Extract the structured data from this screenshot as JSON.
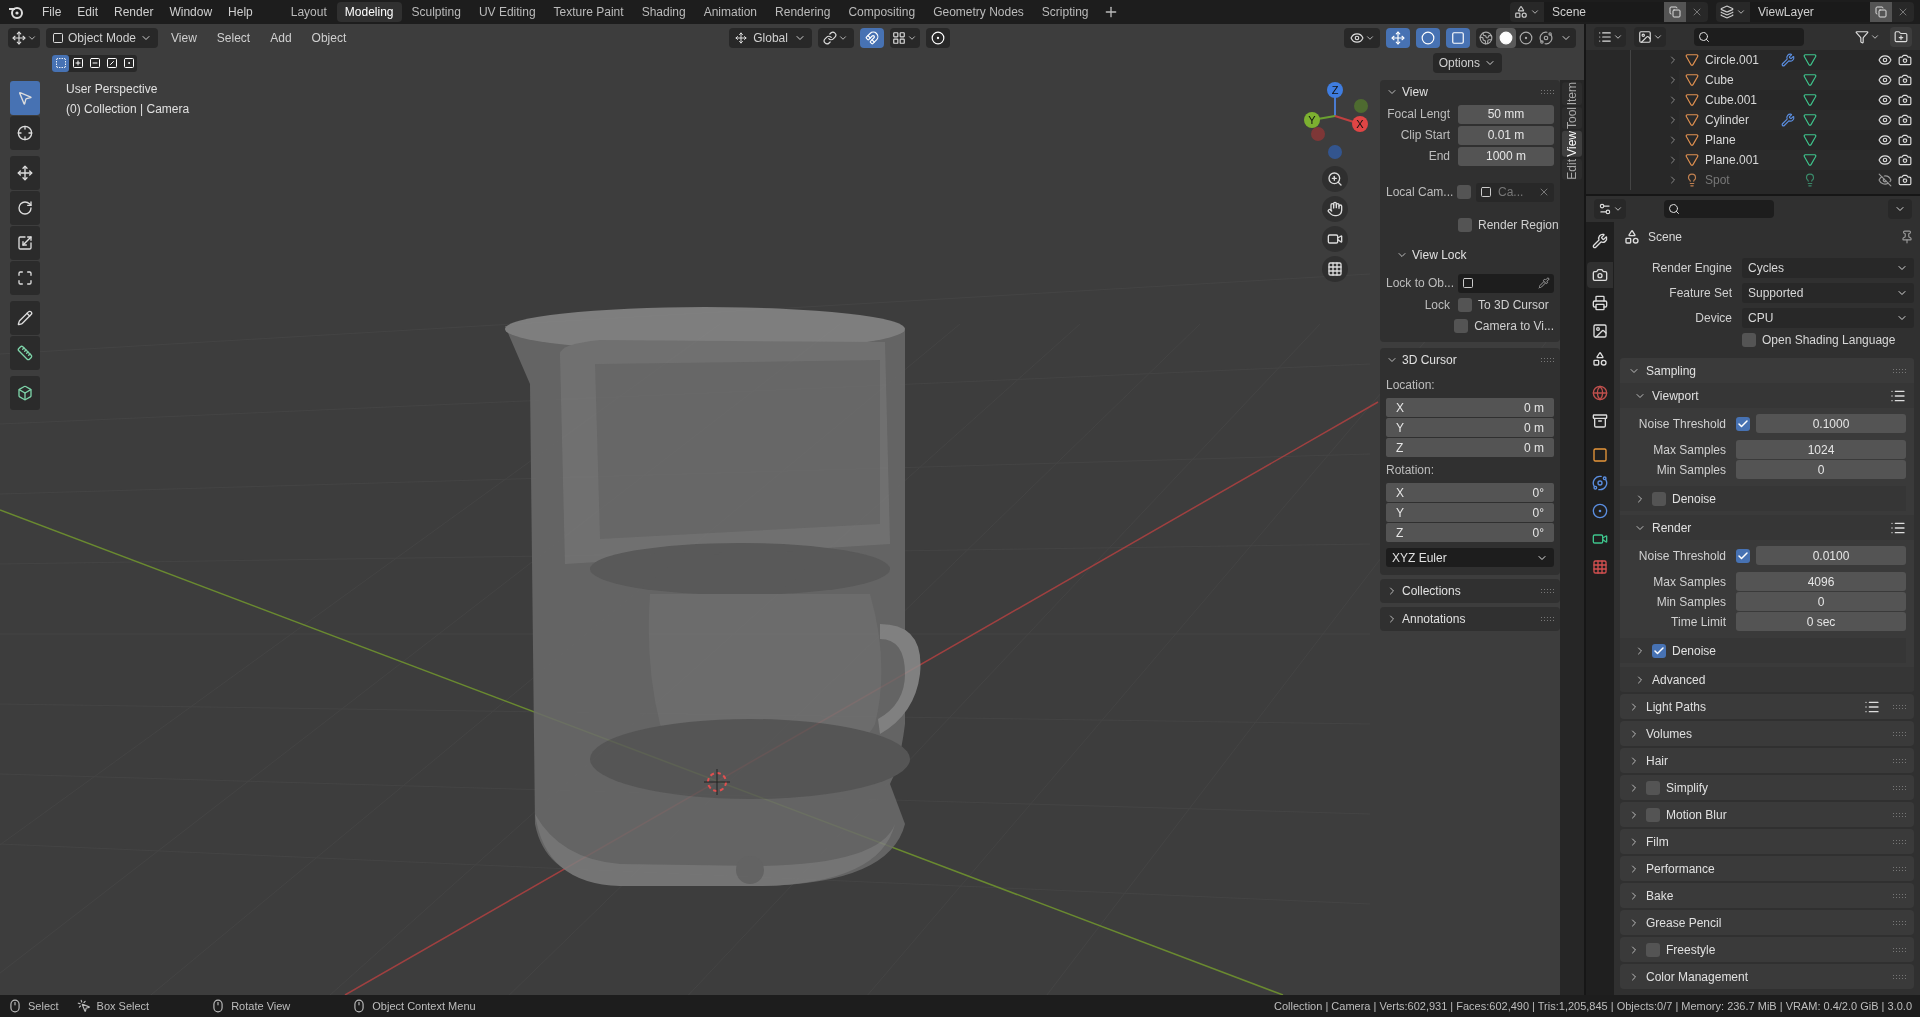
{
  "menu_bar": [
    "File",
    "Edit",
    "Render",
    "Window",
    "Help"
  ],
  "workspace_tabs": [
    {
      "label": "Layout",
      "selected": false
    },
    {
      "label": "Modeling",
      "selected": true
    },
    {
      "label": "Sculpting",
      "selected": false
    },
    {
      "label": "UV Editing",
      "selected": false
    },
    {
      "label": "Texture Paint",
      "selected": false
    },
    {
      "label": "Shading",
      "selected": false
    },
    {
      "label": "Animation",
      "selected": false
    },
    {
      "label": "Rendering",
      "selected": false
    },
    {
      "label": "Compositing",
      "selected": false
    },
    {
      "label": "Geometry Nodes",
      "selected": false
    },
    {
      "label": "Scripting",
      "selected": false
    }
  ],
  "scene": "Scene",
  "view_layer": "ViewLayer",
  "viewport_header": {
    "mode": "Object Mode",
    "menus": [
      "View",
      "Select",
      "Add",
      "Object"
    ],
    "orientation": "Global",
    "snapping": true,
    "proportional_editing": false,
    "gizmos_on": true,
    "overlays_on": true,
    "xray_on": true,
    "shading_modes": [
      {
        "kind": "wireframe",
        "selected": false
      },
      {
        "kind": "solid",
        "selected": true
      },
      {
        "kind": "material",
        "selected": false
      },
      {
        "kind": "rendered",
        "selected": false
      }
    ],
    "select_modes": [
      {
        "kind": "set",
        "selected": true
      },
      {
        "kind": "extend",
        "selected": false
      },
      {
        "kind": "subtract",
        "selected": false
      },
      {
        "kind": "invert",
        "selected": false
      },
      {
        "kind": "intersect",
        "selected": false
      }
    ],
    "options": "Options"
  },
  "viewport": {
    "perspective": "User Perspective",
    "context": "(0) Collection | Camera",
    "gizmo": {
      "x": "X",
      "y": "Y",
      "z": "Z"
    }
  },
  "tools": [
    {
      "kind": "select",
      "selected": true
    },
    {
      "kind": "cursor",
      "selected": false
    },
    {
      "kind": "move",
      "selected": false
    },
    {
      "kind": "rotate",
      "selected": false
    },
    {
      "kind": "scale",
      "selected": false
    },
    {
      "kind": "transform",
      "selected": false
    },
    {
      "kind": "annotate",
      "selected": false
    },
    {
      "kind": "measure",
      "selected": false
    },
    {
      "kind": "add-cube",
      "selected": false
    }
  ],
  "sidebar": {
    "tabs": [
      {
        "label": "Item",
        "selected": false
      },
      {
        "label": "Tool",
        "selected": false
      },
      {
        "label": "View",
        "selected": true
      },
      {
        "label": "Edit",
        "selected": false
      }
    ],
    "view_panel": {
      "title": "View",
      "expanded": true,
      "fields": [
        {
          "label": "Focal Lengt",
          "value": "50 mm"
        },
        {
          "label": "Clip Start",
          "value": "0.01 m"
        },
        {
          "label": "End",
          "value": "1000 m"
        }
      ],
      "local_camera": {
        "label": "Local Cam...",
        "checked": false,
        "object": "Ca..."
      },
      "render_region": {
        "label": "Render Region",
        "checked": false
      },
      "view_lock": {
        "title": "View Lock",
        "expanded": true,
        "lock_to_object": "Lock to Ob...",
        "lock": "Lock",
        "options": [
          {
            "label": "To 3D Cursor",
            "checked": false
          },
          {
            "label": "Camera to Vi...",
            "checked": false
          }
        ]
      }
    },
    "cursor_panel": {
      "title": "3D Cursor",
      "expanded": true,
      "location_label": "Location:",
      "location": [
        {
          "axis": "X",
          "value": "0 m"
        },
        {
          "axis": "Y",
          "value": "0 m"
        },
        {
          "axis": "Z",
          "value": "0 m"
        }
      ],
      "rotation_label": "Rotation:",
      "rotation": [
        {
          "axis": "X",
          "value": "0°"
        },
        {
          "axis": "Y",
          "value": "0°"
        },
        {
          "axis": "Z",
          "value": "0°"
        }
      ],
      "rotation_mode": "XYZ Euler"
    },
    "collapsed_panels": [
      {
        "title": "Collections",
        "expanded": false
      },
      {
        "title": "Annotations",
        "expanded": false
      }
    ]
  },
  "outliner": [
    {
      "name": "Circle.001",
      "kind": "mesh",
      "modifier": true,
      "visible": true
    },
    {
      "name": "Cube",
      "kind": "mesh",
      "modifier": false,
      "visible": true
    },
    {
      "name": "Cube.001",
      "kind": "mesh",
      "modifier": false,
      "visible": true
    },
    {
      "name": "Cylinder",
      "kind": "mesh",
      "modifier": true,
      "visible": true
    },
    {
      "name": "Plane",
      "kind": "mesh",
      "modifier": false,
      "visible": true
    },
    {
      "name": "Plane.001",
      "kind": "mesh",
      "modifier": false,
      "visible": true
    },
    {
      "name": "Spot",
      "kind": "light",
      "modifier": false,
      "visible": false
    }
  ],
  "properties": {
    "tabs": [
      {
        "kind": "tool",
        "selected": false
      },
      {
        "kind": "render",
        "selected": true
      },
      {
        "kind": "output",
        "selected": false
      },
      {
        "kind": "view-layer",
        "selected": false
      },
      {
        "kind": "scene",
        "selected": false
      },
      {
        "kind": "world",
        "selected": false
      },
      {
        "kind": "collection",
        "selected": false
      },
      {
        "kind": "object",
        "selected": false
      },
      {
        "kind": "physics",
        "selected": false
      },
      {
        "kind": "constraint",
        "selected": false
      },
      {
        "kind": "data",
        "selected": false
      },
      {
        "kind": "texture",
        "selected": false
      }
    ],
    "context": "Scene",
    "fields": [
      {
        "label": "Render Engine",
        "value": "Cycles"
      },
      {
        "label": "Feature Set",
        "value": "Supported"
      },
      {
        "label": "Device",
        "value": "CPU"
      }
    ],
    "osl": {
      "label": "Open Shading Language",
      "checked": false
    },
    "sampling": {
      "title": "Sampling",
      "expanded": true,
      "subpanels": [
        {
          "title": "Viewport",
          "expanded": true,
          "rows": [
            {
              "kind": "toggle-number",
              "label": "Noise Threshold",
              "checked": true,
              "value": "0.1000"
            },
            {
              "kind": "number",
              "label": "Max Samples",
              "value": "1024"
            },
            {
              "kind": "number",
              "label": "Min Samples",
              "value": "0"
            }
          ],
          "children": [
            {
              "title": "Denoise",
              "expanded": false,
              "checked": false
            }
          ]
        },
        {
          "title": "Render",
          "expanded": true,
          "rows": [
            {
              "kind": "toggle-number",
              "label": "Noise Threshold",
              "checked": true,
              "value": "0.0100"
            },
            {
              "kind": "number",
              "label": "Max Samples",
              "value": "4096"
            },
            {
              "kind": "number",
              "label": "Min Samples",
              "value": "0"
            },
            {
              "kind": "number",
              "label": "Time Limit",
              "value": "0 sec"
            }
          ],
          "children": [
            {
              "title": "Denoise",
              "expanded": false,
              "checked": true
            }
          ]
        },
        {
          "title": "Advanced",
          "expanded": false
        }
      ]
    },
    "panels": [
      {
        "title": "Light Paths",
        "expanded": false,
        "presets": true
      },
      {
        "title": "Volumes",
        "expanded": false
      },
      {
        "title": "Hair",
        "expanded": false
      },
      {
        "title": "Simplify",
        "expanded": false,
        "checked": false
      },
      {
        "title": "Motion Blur",
        "expanded": false,
        "checked": false
      },
      {
        "title": "Film",
        "expanded": false
      },
      {
        "title": "Performance",
        "expanded": false
      },
      {
        "title": "Bake",
        "expanded": false
      },
      {
        "title": "Grease Pencil",
        "expanded": false
      },
      {
        "title": "Freestyle",
        "expanded": false,
        "checked": false
      },
      {
        "title": "Color Management",
        "expanded": false
      }
    ]
  },
  "status_bar": {
    "hints": [
      {
        "kind": "left",
        "label": "Select"
      },
      {
        "kind": "drag",
        "label": "Box Select"
      },
      {
        "kind": "middle",
        "label": "Rotate View"
      },
      {
        "kind": "right",
        "label": "Object Context Menu"
      }
    ],
    "stats": "Collection | Camera | Verts:602,931 | Faces:602,490 | Tris:1,205,845 | Objects:0/7 | Memory: 236.7 MiB | VRAM: 0.4/2.0 GiB | 3.0.0"
  }
}
